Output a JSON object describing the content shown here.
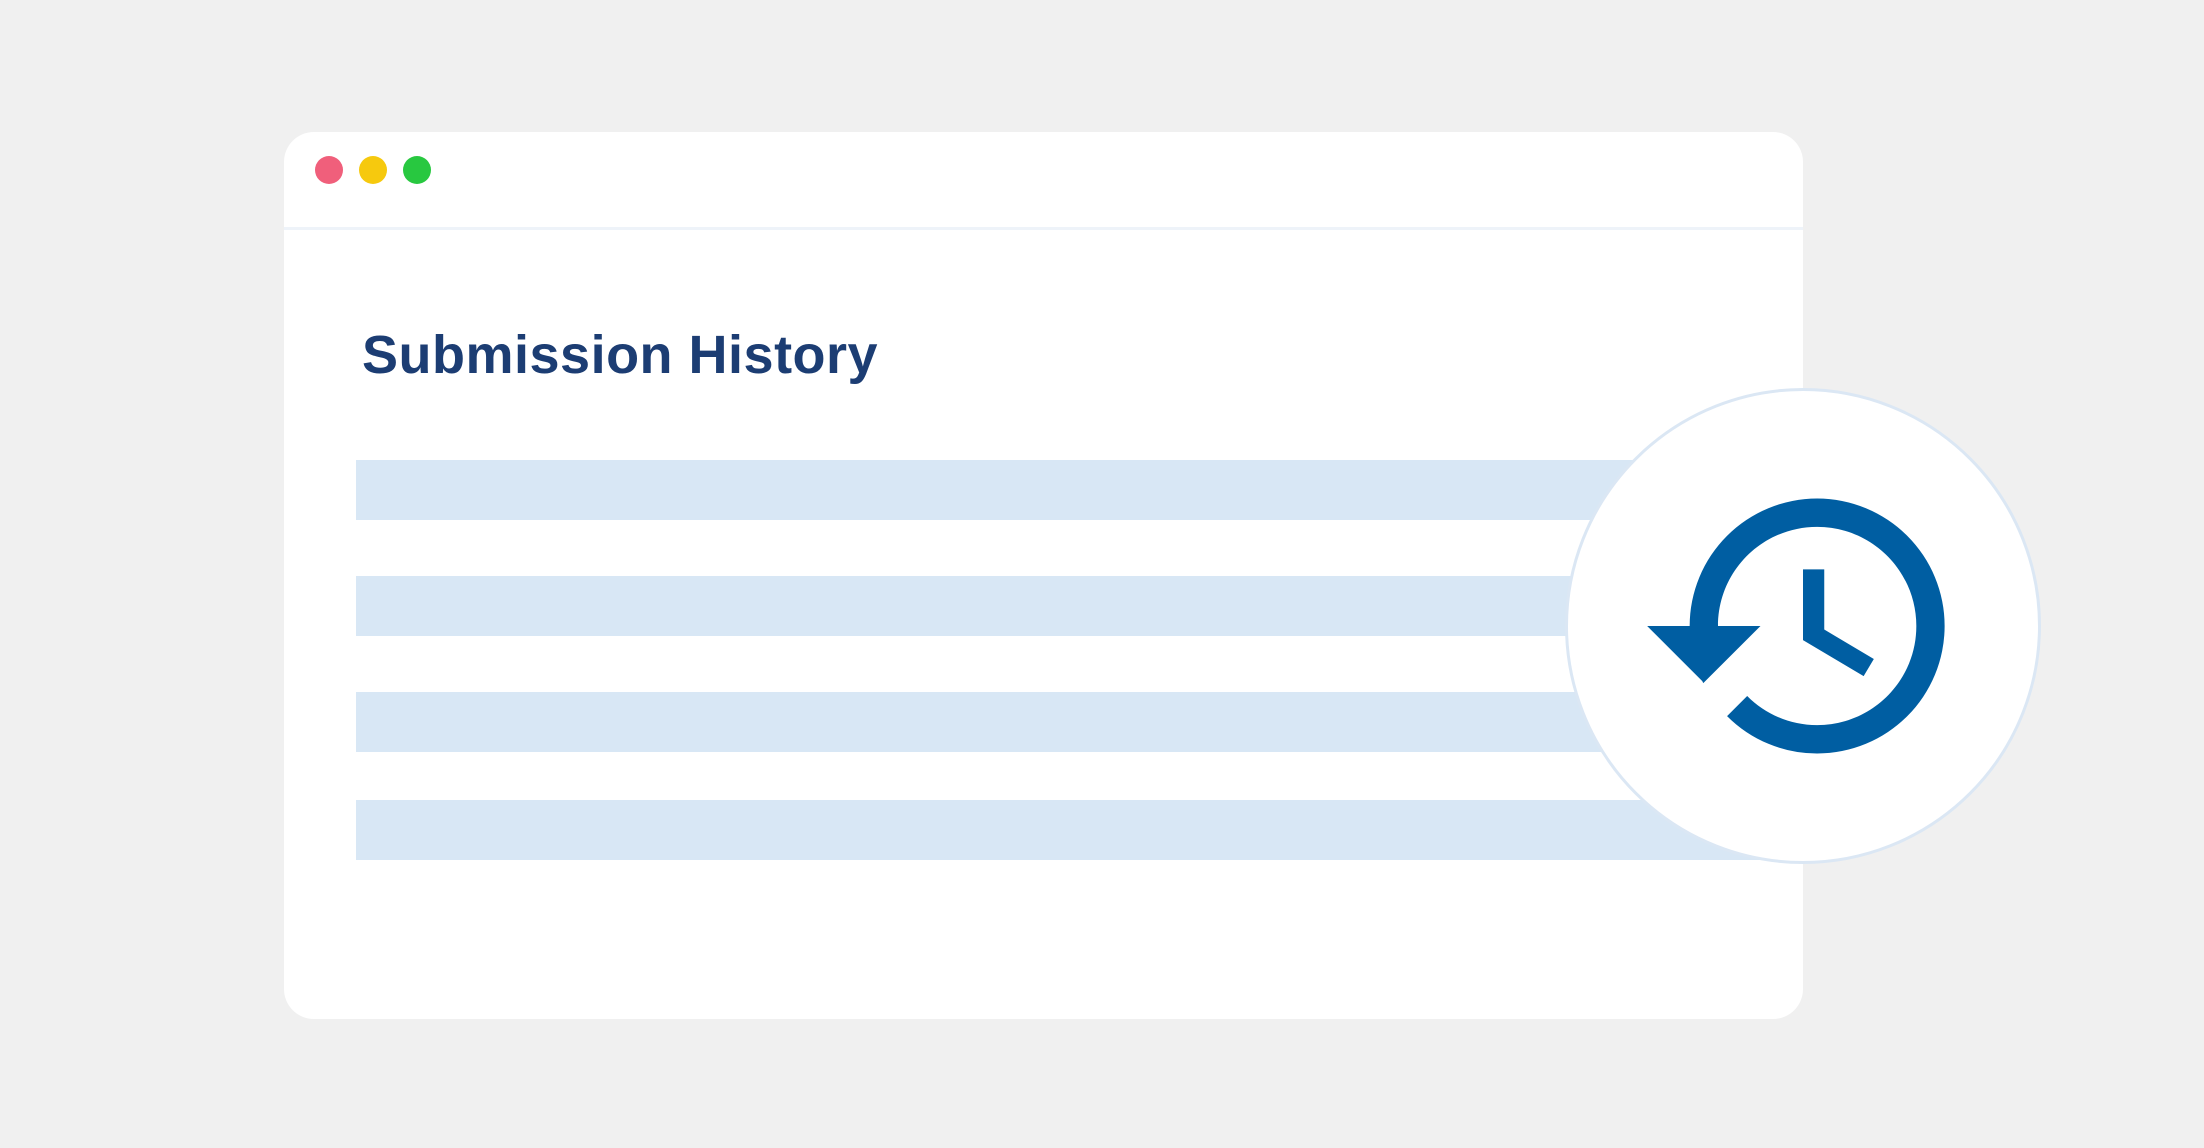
{
  "window": {
    "controls": [
      {
        "name": "close",
        "color": "#f05f7b"
      },
      {
        "name": "minimize",
        "color": "#f6c90e"
      },
      {
        "name": "maximize",
        "color": "#28c840"
      }
    ]
  },
  "main": {
    "title": "Submission History",
    "title_color": "#1c3d73",
    "placeholder_row_color": "#d8e7f5",
    "placeholder_rows": 4
  },
  "badge": {
    "icon": "history-clock-icon",
    "icon_color": "#005ea2"
  }
}
